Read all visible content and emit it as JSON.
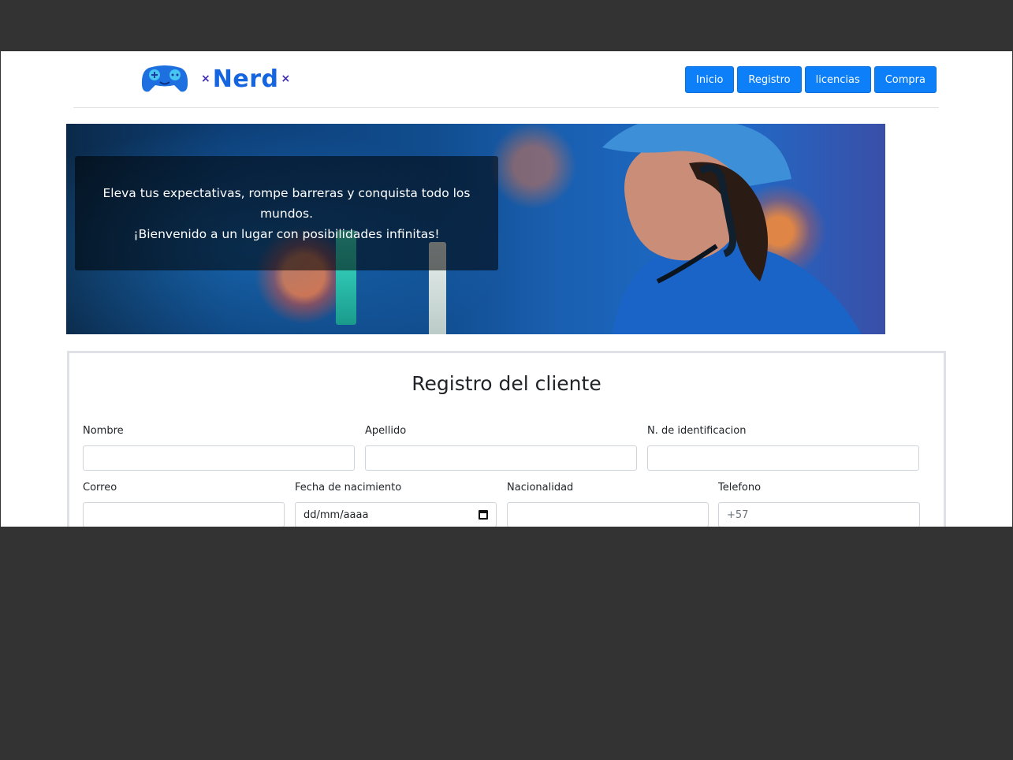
{
  "brand": {
    "name": "Nerd",
    "decor_left": "×",
    "decor_right": "×",
    "logo_icon": "gamepad-icon"
  },
  "nav": {
    "items": [
      {
        "label": "Inicio"
      },
      {
        "label": "Registro"
      },
      {
        "label": "licencias"
      },
      {
        "label": "Compra"
      }
    ]
  },
  "hero": {
    "line1": "Eleva tus expectativas, rompe barreras y conquista todo los mundos.",
    "line2": "¡Bienvenido a un lugar con posibilidades infinitas!"
  },
  "form": {
    "title": "Registro del cliente",
    "fields": {
      "nombre": {
        "label": "Nombre",
        "value": ""
      },
      "apellido": {
        "label": "Apellido",
        "value": ""
      },
      "identificacion": {
        "label": "N. de identificacion",
        "value": ""
      },
      "correo": {
        "label": "Correo",
        "value": ""
      },
      "fecha": {
        "label": "Fecha de nacimiento",
        "placeholder": "dd/mm/aaaa"
      },
      "nacionalidad": {
        "label": "Nacionalidad",
        "value": ""
      },
      "telefono": {
        "label": "Telefono",
        "placeholder": "+57"
      }
    }
  },
  "colors": {
    "accent": "#0d7ff8",
    "brand_blue": "#1565e0",
    "brand_purple": "#3b2bb5",
    "frame": "#333333"
  }
}
